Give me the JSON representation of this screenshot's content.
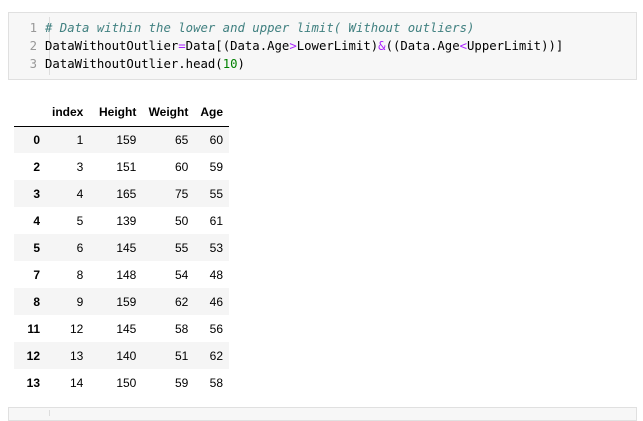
{
  "code_cell": {
    "lines": [
      {
        "number": "1",
        "tokens": [
          {
            "text": "# Data within the lower and upper limit( Without outliers)",
            "kind": "comment"
          }
        ]
      },
      {
        "number": "2",
        "tokens": [
          {
            "text": "DataWithoutOutlier",
            "kind": "plain"
          },
          {
            "text": "=",
            "kind": "op"
          },
          {
            "text": "Data[(Data.Age",
            "kind": "plain"
          },
          {
            "text": ">",
            "kind": "op"
          },
          {
            "text": "LowerLimit)",
            "kind": "plain"
          },
          {
            "text": "&",
            "kind": "op"
          },
          {
            "text": "((Data.Age",
            "kind": "plain"
          },
          {
            "text": "<",
            "kind": "op"
          },
          {
            "text": "UpperLimit))]",
            "kind": "plain"
          }
        ]
      },
      {
        "number": "3",
        "tokens": [
          {
            "text": "DataWithoutOutlier.head(",
            "kind": "plain"
          },
          {
            "text": "10",
            "kind": "num"
          },
          {
            "text": ")",
            "kind": "plain"
          }
        ]
      }
    ]
  },
  "table": {
    "columns": [
      "index",
      "Height",
      "Weight",
      "Age"
    ],
    "rows": [
      {
        "idx": "0",
        "values": [
          "1",
          "159",
          "65",
          "60"
        ]
      },
      {
        "idx": "2",
        "values": [
          "3",
          "151",
          "60",
          "59"
        ]
      },
      {
        "idx": "3",
        "values": [
          "4",
          "165",
          "75",
          "55"
        ]
      },
      {
        "idx": "4",
        "values": [
          "5",
          "139",
          "50",
          "61"
        ]
      },
      {
        "idx": "5",
        "values": [
          "6",
          "145",
          "55",
          "53"
        ]
      },
      {
        "idx": "7",
        "values": [
          "8",
          "148",
          "54",
          "48"
        ]
      },
      {
        "idx": "8",
        "values": [
          "9",
          "159",
          "62",
          "46"
        ]
      },
      {
        "idx": "11",
        "values": [
          "12",
          "145",
          "58",
          "56"
        ]
      },
      {
        "idx": "12",
        "values": [
          "13",
          "140",
          "51",
          "62"
        ]
      },
      {
        "idx": "13",
        "values": [
          "14",
          "150",
          "59",
          "58"
        ]
      }
    ]
  },
  "colors": {
    "comment": "#408080",
    "operator": "#aa22ff",
    "number": "#008000",
    "code_background": "#f7f7f7",
    "row_stripe": "#f5f5f5"
  }
}
